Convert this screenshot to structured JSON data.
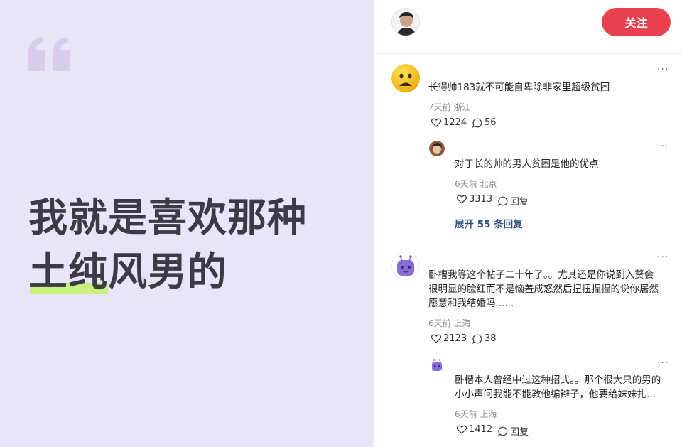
{
  "left_panel": {
    "quote_line1": "我就是喜欢那种",
    "quote_highlight": "土纯",
    "quote_rest": "风男的",
    "colors": {
      "background": "#e8e5f9",
      "highlight": "#c9ef7d",
      "quote_mark": "#d8cdea"
    }
  },
  "header": {
    "follow_label": "关注",
    "follow_color": "#e9414f"
  },
  "comments": [
    {
      "text": "长得帅183就不可能自卑除非家里超级贫困",
      "meta": "7天前 浙江",
      "likes": "1224",
      "replies_count": "56",
      "more": "···",
      "reply": {
        "text": "对于长的帅的男人贫困是他的优点",
        "meta": "6天前 北京",
        "likes": "3313",
        "reply_label": "回复",
        "more": "···"
      },
      "expand_label": "展开 55 条回复"
    },
    {
      "text_line1": "卧槽我等这个帖子二十年了。。尤其还是你说到入赘会",
      "text_line2": "很明显的脸红而不是恼羞成怒然后扭扭捏捏的说你居然",
      "text_line3": "愿意和我结婚吗......",
      "meta": "6天前 上海",
      "likes": "2123",
      "replies_count": "38",
      "more": "···",
      "reply": {
        "text_line1": "卧槽本人曾经中过这种招式。。那个很大只的男的",
        "text_line2": "小小声问我能不能教他编辫子，他要给妹妹扎...",
        "meta": "6天前 上海",
        "likes": "1412",
        "reply_label": "回复",
        "more": "···"
      }
    }
  ]
}
